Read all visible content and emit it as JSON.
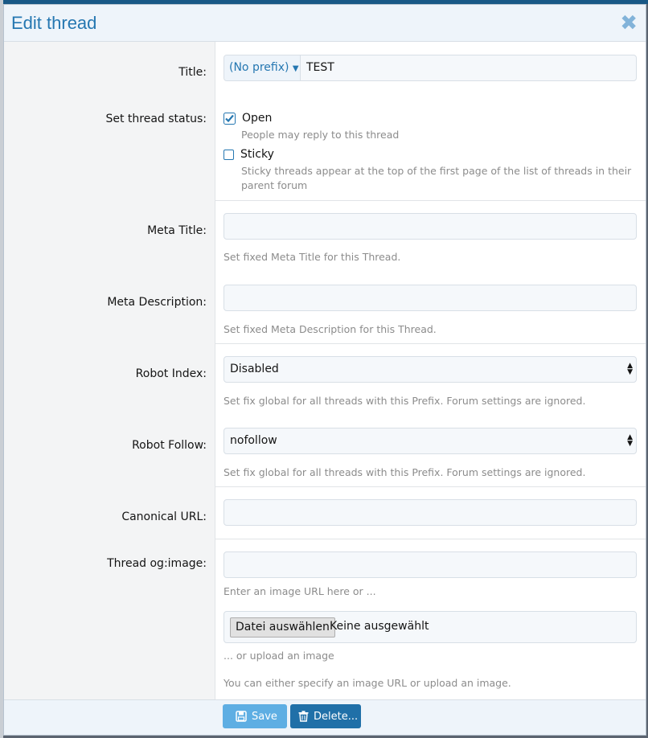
{
  "dialog": {
    "title": "Edit thread",
    "close_icon": "close-icon"
  },
  "fields": {
    "title": {
      "label": "Title:",
      "prefix": "(No prefix)",
      "value": "TEST"
    },
    "status": {
      "label": "Set thread status:",
      "open_label": "Open",
      "open_checked": true,
      "open_hint": "People may reply to this thread",
      "sticky_label": "Sticky",
      "sticky_checked": false,
      "sticky_hint": "Sticky threads appear at the top of the first page of the list of threads in their parent forum"
    },
    "meta_title": {
      "label": "Meta Title:",
      "value": "",
      "hint": "Set fixed Meta Title for this Thread."
    },
    "meta_description": {
      "label": "Meta Description:",
      "value": "",
      "hint": "Set fixed Meta Description for this Thread."
    },
    "robot_index": {
      "label": "Robot Index:",
      "value": "Disabled",
      "hint": "Set fix global for all threads with this Prefix. Forum settings are ignored."
    },
    "robot_follow": {
      "label": "Robot Follow:",
      "value": "nofollow",
      "hint": "Set fix global for all threads with this Prefix. Forum settings are ignored."
    },
    "canonical_url": {
      "label": "Canonical URL:",
      "value": ""
    },
    "og_image": {
      "label": "Thread og:image:",
      "value": "",
      "url_hint": "Enter an image URL here or ...",
      "file_button": "Datei auswählen",
      "file_status": "Keine ausgewählt",
      "upload_hint": "... or upload an image",
      "either_hint": "You can either specify an image URL or upload an image."
    }
  },
  "footer": {
    "save_label": "Save",
    "delete_label": "Delete..."
  },
  "colors": {
    "accent": "#2577b1",
    "save_button": "#5eaee3",
    "delete_button": "#2070a8"
  }
}
